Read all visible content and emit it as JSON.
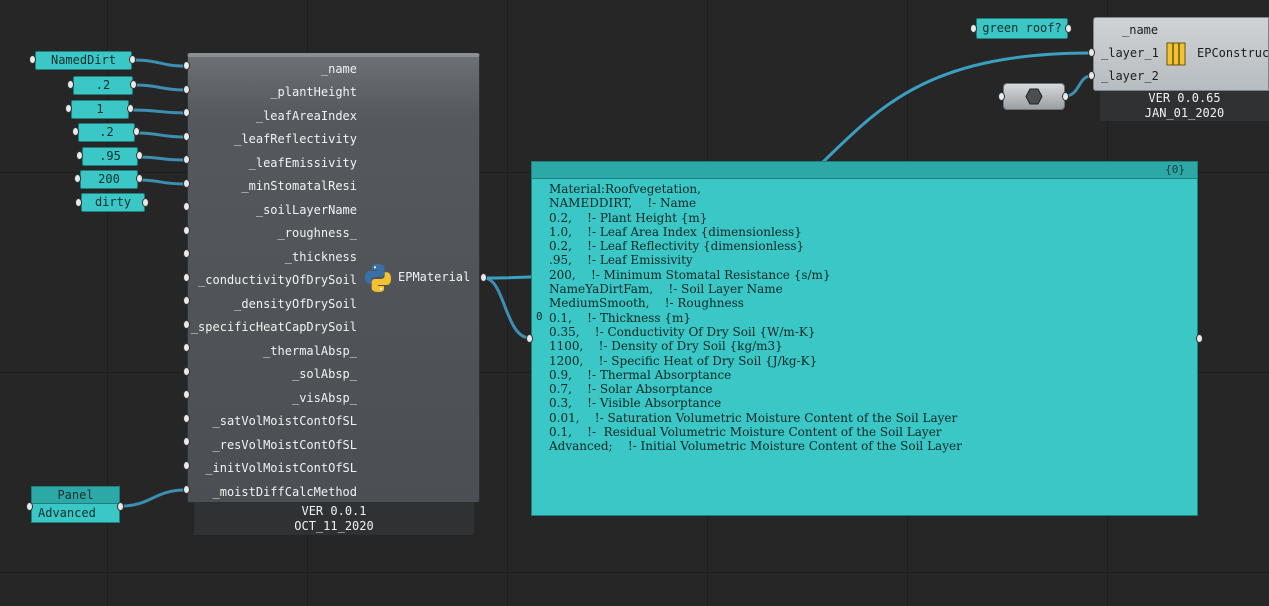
{
  "inputs": {
    "name": "NamedDirt",
    "plant_height": ".2",
    "leaf_area_index": "1",
    "leaf_reflectivity": ".2",
    "leaf_emissivity": ".95",
    "min_stomatal_resi": "200",
    "soil_layer_name": "dirty"
  },
  "ep_material": {
    "inputs": [
      "_name",
      "_plantHeight",
      "_leafAreaIndex",
      "_leafReflectivity",
      "_leafEmissivity",
      "_minStomatalResi",
      "_soilLayerName",
      "_roughness_",
      "_thickness",
      "_conductivityOfDrySoil",
      "_densityOfDrySoil",
      "_specificHeatCapDrySoil",
      "_thermalAbsp_",
      "_solAbsp_",
      "_visAbsp_",
      "_satVolMoistContOfSL",
      "_resVolMoistContOfSL",
      "_initVolMoistContOfSL",
      "_moistDiffCalcMethod"
    ],
    "output": "EPMaterial",
    "version": "VER 0.0.1",
    "date": "OCT_11_2020"
  },
  "output_panel": {
    "index": "{0}",
    "path_index": "0",
    "text": "Material:Roofvegetation,\nNAMEDDIRT,    !- Name\n0.2,    !- Plant Height {m}\n1.0,    !- Leaf Area Index {dimensionless}\n0.2,    !- Leaf Reflectivity {dimensionless}\n.95,    !- Leaf Emissivity\n200,    !- Minimum Stomatal Resistance {s/m}\nNameYaDirtFam,    !- Soil Layer Name\nMediumSmooth,    !- Roughness\n0.1,    !- Thickness {m}\n0.35,    !- Conductivity Of Dry Soil {W/m-K}\n1100,    !- Density of Dry Soil {kg/m3}\n1200,    !- Specific Heat of Dry Soil {J/kg-K}\n0.9,    !- Thermal Absorptance\n0.7,    !- Solar Absorptance\n0.3,    !- Visible Absorptance\n0.01,    !- Saturation Volumetric Moisture Content of the Soil Layer\n0.1,    !-  Residual Volumetric Moisture Content of the Soil Layer\nAdvanced;    !- Initial Volumetric Moisture Content of the Soil Layer"
  },
  "green_roof_param": "green roof?",
  "ep_construction": {
    "inputs": [
      "_name",
      "_layer_1",
      "_layer_2"
    ],
    "title": "EPConstruct",
    "version": "VER 0.0.65",
    "date": "JAN_01_2020"
  },
  "advanced_panel": {
    "title": "Panel",
    "value": "Advanced"
  },
  "colors": {
    "wire": "#3b8fb0",
    "panel": "#3ac7c6",
    "canvas": "#262626"
  }
}
